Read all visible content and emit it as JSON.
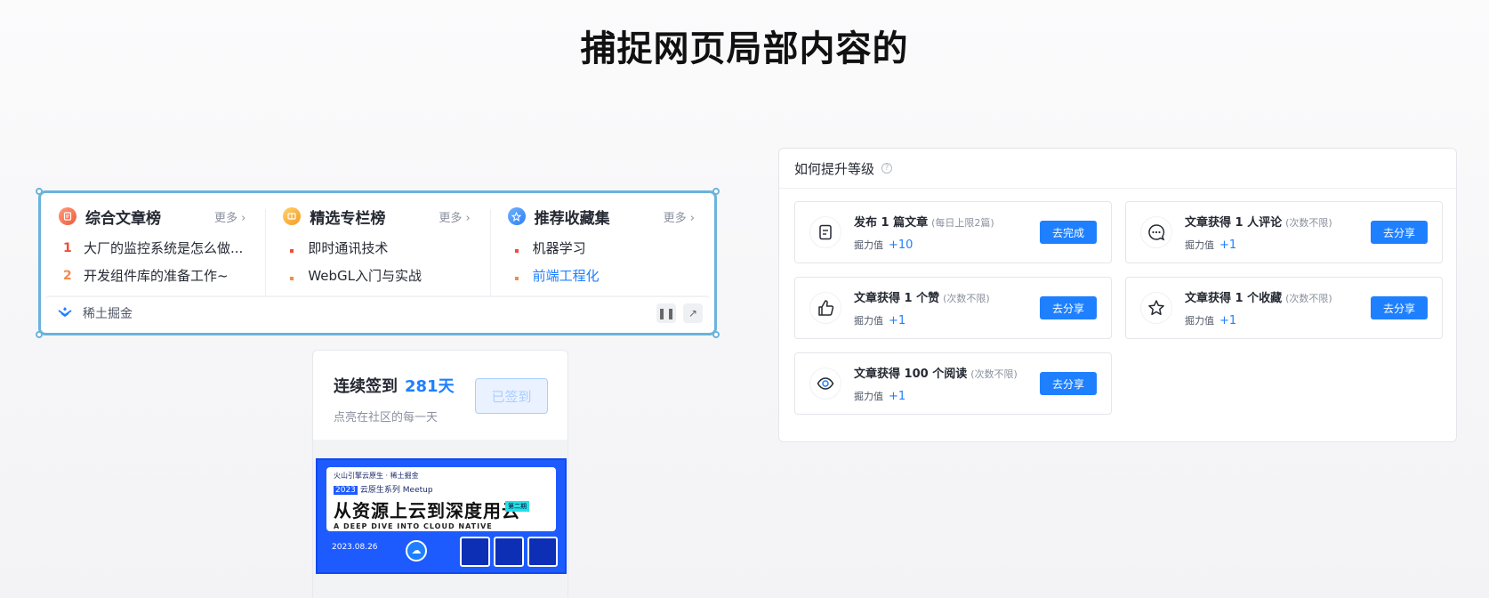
{
  "page": {
    "title": "捕捉网页局部内容的"
  },
  "rank_widget": {
    "columns": [
      {
        "title": "综合文章榜",
        "more": "更多 ›",
        "items": [
          {
            "marker": "1",
            "text": "大厂的监控系统是怎么做..."
          },
          {
            "marker": "2",
            "text": "开发组件库的准备工作~"
          }
        ]
      },
      {
        "title": "精选专栏榜",
        "more": "更多 ›",
        "items": [
          {
            "text": "即时通讯技术"
          },
          {
            "text": "WebGL入门与实战"
          }
        ]
      },
      {
        "title": "推荐收藏集",
        "more": "更多 ›",
        "items": [
          {
            "text": "机器学习"
          },
          {
            "text": "前端工程化"
          }
        ]
      }
    ],
    "footer": {
      "brand": "稀土掘金",
      "pause_icon": "pause-icon",
      "open_icon": "external-arrow-icon"
    }
  },
  "sign_in": {
    "title": "连续签到",
    "days": "281天",
    "subtitle": "点亮在社区的每一天",
    "button": "已签到",
    "banner": {
      "org": "火山引擎云原生 · 稀土掘金",
      "year": "2023",
      "series": "云原生系列 Meetup",
      "headline": "从资源上云到深度用云",
      "english": "A DEEP DIVE INTO CLOUD NATIVE",
      "tag": "第二期",
      "date": "2023.08.26"
    }
  },
  "level_panel": {
    "title": "如何提升等级",
    "points_label": "掘力值",
    "tasks": [
      {
        "title": "发布 1 篇文章",
        "note": "(每日上限2篇)",
        "points": "+10",
        "button": "去完成",
        "icon": "document-icon"
      },
      {
        "title": "文章获得 1 人评论",
        "note": "(次数不限)",
        "points": "+1",
        "button": "去分享",
        "icon": "comment-icon"
      },
      {
        "title": "文章获得 1 个赞",
        "note": "(次数不限)",
        "points": "+1",
        "button": "去分享",
        "icon": "thumbs-up-icon"
      },
      {
        "title": "文章获得 1 个收藏",
        "note": "(次数不限)",
        "points": "+1",
        "button": "去分享",
        "icon": "star-icon"
      },
      {
        "title": "文章获得 100 个阅读",
        "note": "(次数不限)",
        "points": "+1",
        "button": "去分享",
        "icon": "eye-icon"
      }
    ]
  },
  "colors": {
    "accent": "#1e80ff",
    "selection": "#6ab3dc",
    "rank_red": "#f04b3c",
    "rank_orange": "#f58a4b"
  }
}
